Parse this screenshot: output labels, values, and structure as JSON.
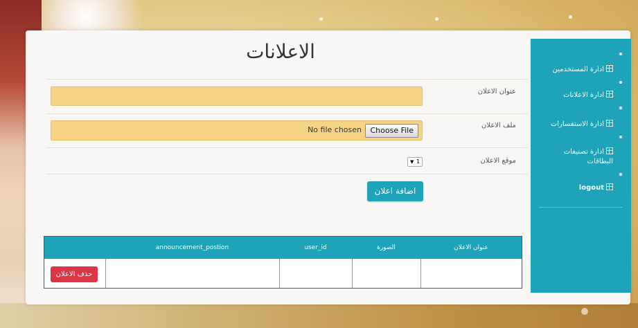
{
  "page": {
    "title": "الاعلانات"
  },
  "sidebar": {
    "items": [
      {
        "label": "ادارة المستخدمين"
      },
      {
        "label": "ادارة الاعلانات"
      },
      {
        "label": "ادارة الاستفسارات"
      },
      {
        "label": "ادارة تصنيفات البطاقات"
      },
      {
        "label": "logout"
      }
    ]
  },
  "form": {
    "title_label": "عنوان الاعلان",
    "title_value": "",
    "file_label": "ملف الاعلان",
    "file_button": "Choose File",
    "file_status": "No file chosen",
    "position_label": "موقع الاعلان",
    "position_value": "1",
    "submit_label": "اضافة اعلان"
  },
  "table": {
    "headers": [
      "عنوان الاعلان",
      "الصورة",
      "user_id",
      "announcement_postion",
      ""
    ],
    "rows": [
      {
        "cells": [
          "",
          "",
          "",
          ""
        ],
        "delete_label": "حذف الاعلان"
      }
    ]
  },
  "colors": {
    "accent": "#1fa3b8",
    "input_bg": "#f5d486",
    "danger": "#dc3545"
  }
}
